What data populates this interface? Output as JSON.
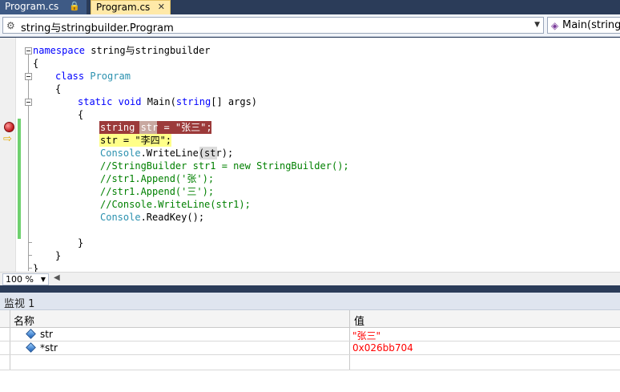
{
  "tabs": [
    {
      "label": "Program.cs",
      "icon": "lock-icon",
      "glyph": "🔒"
    },
    {
      "label": "Program.cs",
      "icon": "close-icon",
      "glyph": "✕"
    }
  ],
  "nav": {
    "left_combo": "string与stringbuilder.Program",
    "right_combo": "Main(string[]"
  },
  "code": {
    "l1_kw": "namespace",
    "l1_rest": " string与stringbuilder",
    "l2": "{",
    "l3_kw": "class",
    "l3_ty": "Program",
    "l4": "{",
    "l5_kw1": "static",
    "l5_kw2": "void",
    "l5_mid": " Main(",
    "l5_kw3": "string",
    "l5_end": "[] args)",
    "l6": "{",
    "l7": "string str = \"张三\";",
    "l8": "str = \"李四\";",
    "l9_ty": "Console",
    "l9_rest": ".WriteLine(str);",
    "l10": "//StringBuilder str1 = new StringBuilder();",
    "l11": "//str1.Append('张');",
    "l12": "//str1.Append('三');",
    "l13": "//Console.WriteLine(str1);",
    "l14_ty": "Console",
    "l14_rest": ".ReadKey();",
    "l15": "}",
    "l16": "}",
    "l17": "}"
  },
  "zoom": "100 %",
  "watch": {
    "title": "监视 1",
    "col_name": "名称",
    "col_value": "值",
    "rows": [
      {
        "name": "str",
        "value": "\"张三\""
      },
      {
        "name": "*str",
        "value": "0x026bb704"
      }
    ]
  },
  "colors": {
    "breakpoint": "#9c3a3a",
    "current_line": "#ffff88",
    "keyword": "#0000ff",
    "type": "#2b91af",
    "comment": "#008000",
    "watch_value": "#ff0000"
  }
}
